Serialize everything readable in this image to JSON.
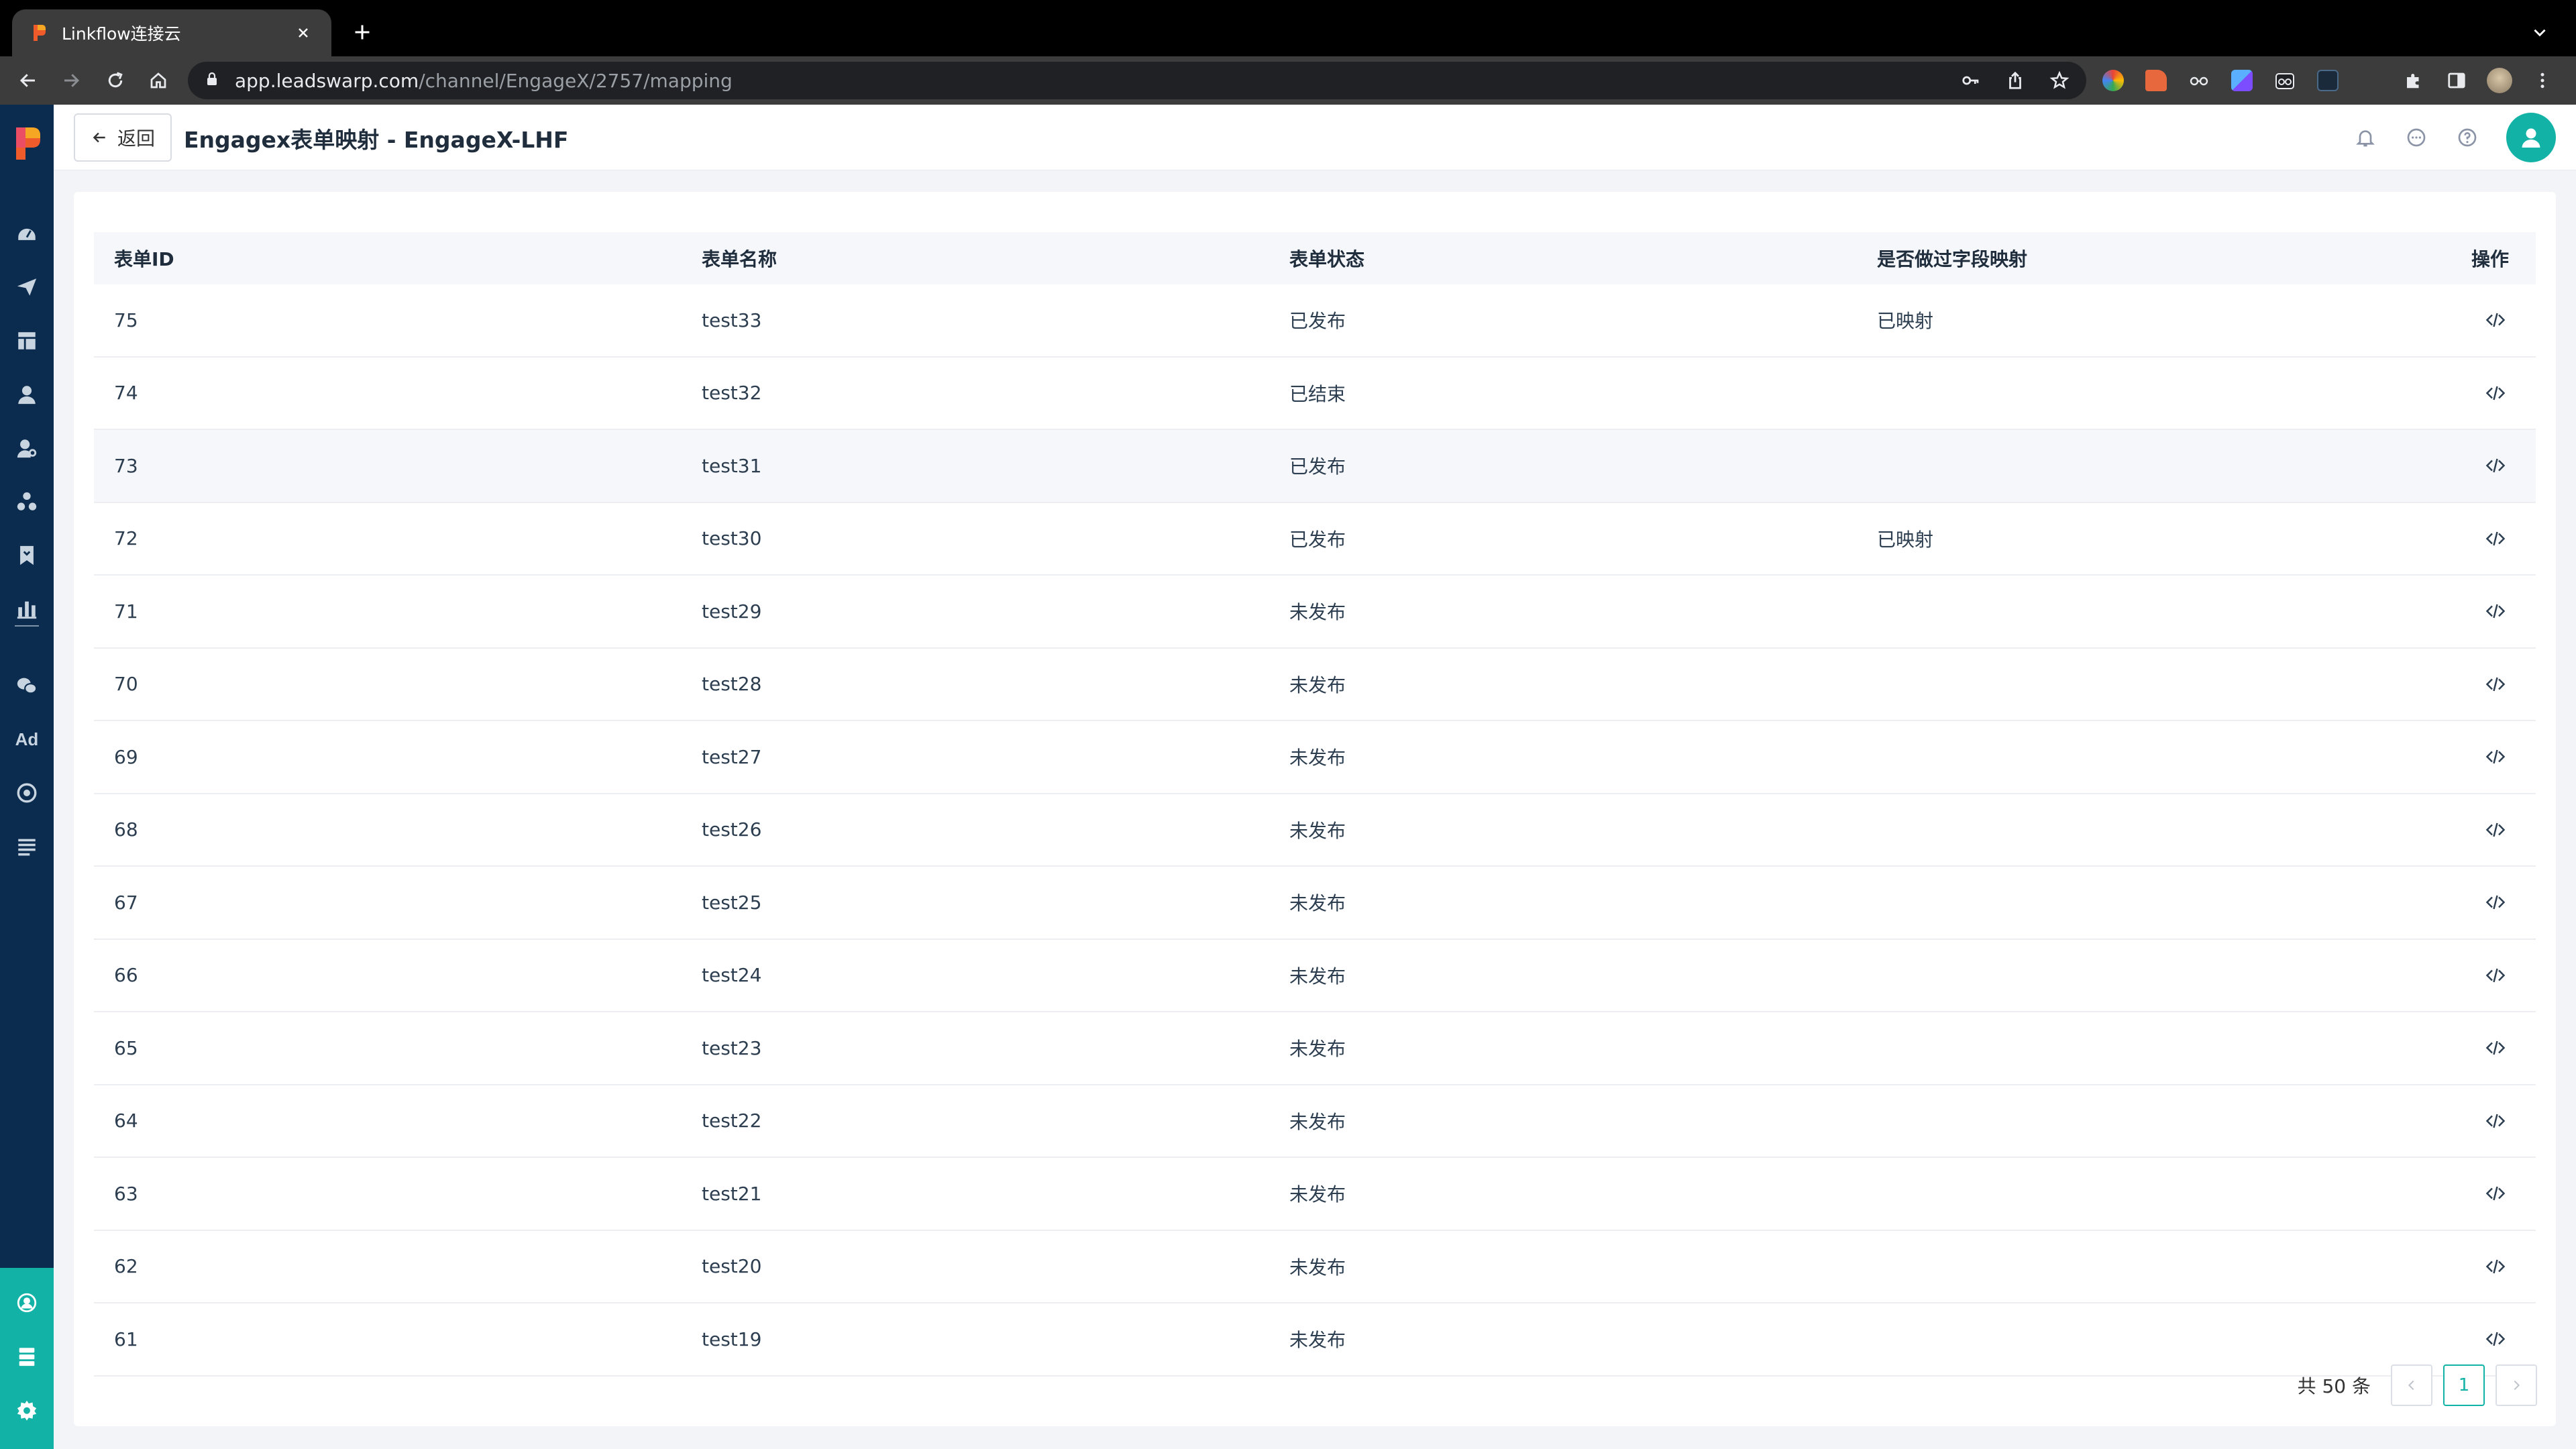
{
  "browser": {
    "tab_title": "Linkflow连接云",
    "url_host": "app.leadswarp.com",
    "url_path": "/channel/EngageX/2757/mapping"
  },
  "header": {
    "back_label": "返回",
    "page_title": "Engagex表单映射 - EngageX-LHF"
  },
  "sidebar": {
    "ad_label": "Ad"
  },
  "table": {
    "columns": [
      "表单ID",
      "表单名称",
      "表单状态",
      "是否做过字段映射",
      "操作"
    ],
    "rows": [
      {
        "id": "75",
        "name": "test33",
        "status": "已发布",
        "mapped": "已映射"
      },
      {
        "id": "74",
        "name": "test32",
        "status": "已结束",
        "mapped": ""
      },
      {
        "id": "73",
        "name": "test31",
        "status": "已发布",
        "mapped": ""
      },
      {
        "id": "72",
        "name": "test30",
        "status": "已发布",
        "mapped": "已映射"
      },
      {
        "id": "71",
        "name": "test29",
        "status": "未发布",
        "mapped": ""
      },
      {
        "id": "70",
        "name": "test28",
        "status": "未发布",
        "mapped": ""
      },
      {
        "id": "69",
        "name": "test27",
        "status": "未发布",
        "mapped": ""
      },
      {
        "id": "68",
        "name": "test26",
        "status": "未发布",
        "mapped": ""
      },
      {
        "id": "67",
        "name": "test25",
        "status": "未发布",
        "mapped": ""
      },
      {
        "id": "66",
        "name": "test24",
        "status": "未发布",
        "mapped": ""
      },
      {
        "id": "65",
        "name": "test23",
        "status": "未发布",
        "mapped": ""
      },
      {
        "id": "64",
        "name": "test22",
        "status": "未发布",
        "mapped": ""
      },
      {
        "id": "63",
        "name": "test21",
        "status": "未发布",
        "mapped": ""
      },
      {
        "id": "62",
        "name": "test20",
        "status": "未发布",
        "mapped": ""
      },
      {
        "id": "61",
        "name": "test19",
        "status": "未发布",
        "mapped": ""
      }
    ]
  },
  "pagination": {
    "total_label": "共 50 条",
    "current_page": "1"
  },
  "colors": {
    "accent": "#12b3a6",
    "sidebar_bg": "#0c2c4f"
  }
}
